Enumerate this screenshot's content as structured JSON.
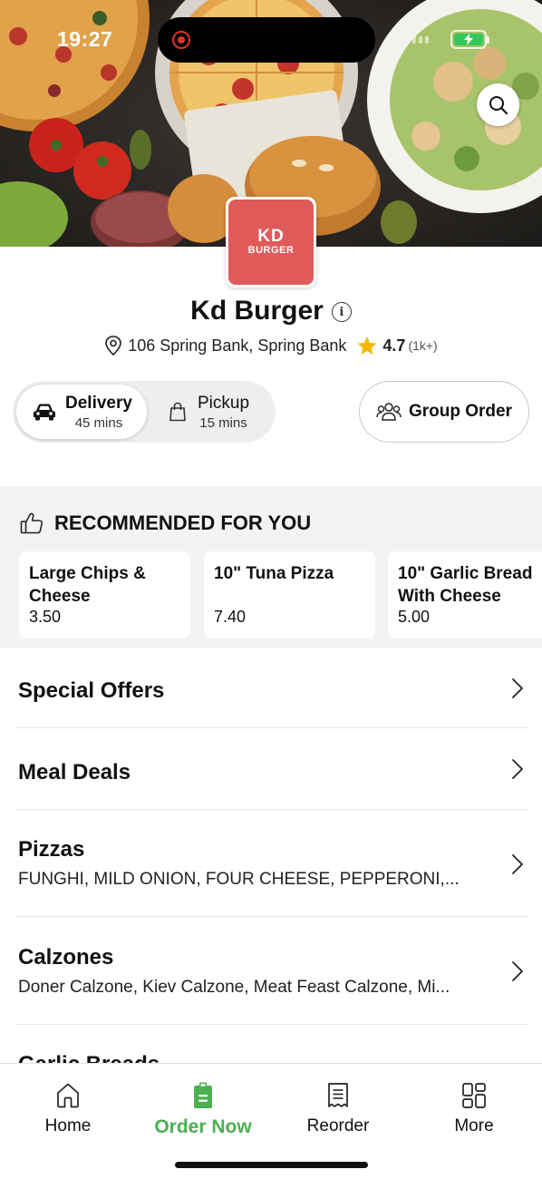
{
  "status_bar": {
    "time": "19:27"
  },
  "restaurant": {
    "logo_line1": "KD",
    "logo_line2": "BURGER",
    "name": "Kd Burger",
    "address": "106 Spring Bank, Spring Bank",
    "rating": "4.7",
    "rating_count": "(1k+)"
  },
  "order_mode": {
    "delivery": {
      "label": "Delivery",
      "time": "45 mins"
    },
    "pickup": {
      "label": "Pickup",
      "time": "15 mins"
    },
    "selected": "Delivery",
    "group_order_label": "Group Order"
  },
  "recommended": {
    "heading": "RECOMMENDED FOR YOU",
    "items": [
      {
        "name": "Large Chips & Cheese",
        "price": "3.50"
      },
      {
        "name": "10\" Tuna Pizza",
        "price": "7.40"
      },
      {
        "name": "10\" Garlic Bread With Cheese",
        "price": "5.00"
      }
    ]
  },
  "categories": [
    {
      "name": "Special Offers",
      "description": ""
    },
    {
      "name": "Meal Deals",
      "description": ""
    },
    {
      "name": "Pizzas",
      "description": "FUNGHI, MILD ONION, FOUR CHEESE, PEPPERONI,..."
    },
    {
      "name": "Calzones",
      "description": "Doner Calzone, Kiev Calzone, Meat Feast Calzone, Mi..."
    },
    {
      "name": "Garlic Breads",
      "description": ""
    }
  ],
  "bottom_nav": [
    {
      "label": "Home",
      "icon": "home-icon"
    },
    {
      "label": "Order Now",
      "icon": "order-icon"
    },
    {
      "label": "Reorder",
      "icon": "receipt-icon"
    },
    {
      "label": "More",
      "icon": "grid-icon"
    }
  ],
  "colors": {
    "accent_green": "#4caf50",
    "logo_red": "#e05a5a",
    "star": "#f5b800",
    "recommended_bg": "#f3f3f3"
  }
}
